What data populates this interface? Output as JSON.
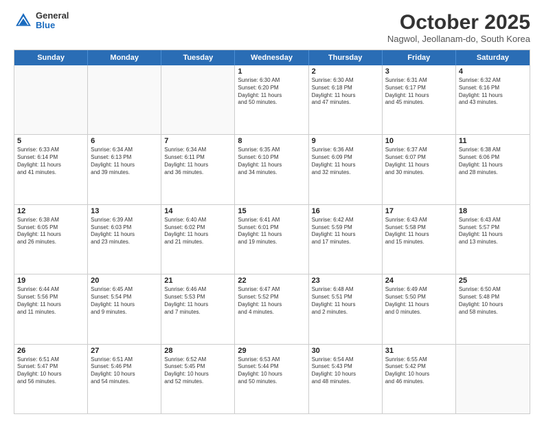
{
  "header": {
    "logo_general": "General",
    "logo_blue": "Blue",
    "month_title": "October 2025",
    "location": "Nagwol, Jeollanam-do, South Korea"
  },
  "days_of_week": [
    "Sunday",
    "Monday",
    "Tuesday",
    "Wednesday",
    "Thursday",
    "Friday",
    "Saturday"
  ],
  "weeks": [
    [
      {
        "day": "",
        "text": ""
      },
      {
        "day": "",
        "text": ""
      },
      {
        "day": "",
        "text": ""
      },
      {
        "day": "1",
        "text": "Sunrise: 6:30 AM\nSunset: 6:20 PM\nDaylight: 11 hours\nand 50 minutes."
      },
      {
        "day": "2",
        "text": "Sunrise: 6:30 AM\nSunset: 6:18 PM\nDaylight: 11 hours\nand 47 minutes."
      },
      {
        "day": "3",
        "text": "Sunrise: 6:31 AM\nSunset: 6:17 PM\nDaylight: 11 hours\nand 45 minutes."
      },
      {
        "day": "4",
        "text": "Sunrise: 6:32 AM\nSunset: 6:16 PM\nDaylight: 11 hours\nand 43 minutes."
      }
    ],
    [
      {
        "day": "5",
        "text": "Sunrise: 6:33 AM\nSunset: 6:14 PM\nDaylight: 11 hours\nand 41 minutes."
      },
      {
        "day": "6",
        "text": "Sunrise: 6:34 AM\nSunset: 6:13 PM\nDaylight: 11 hours\nand 39 minutes."
      },
      {
        "day": "7",
        "text": "Sunrise: 6:34 AM\nSunset: 6:11 PM\nDaylight: 11 hours\nand 36 minutes."
      },
      {
        "day": "8",
        "text": "Sunrise: 6:35 AM\nSunset: 6:10 PM\nDaylight: 11 hours\nand 34 minutes."
      },
      {
        "day": "9",
        "text": "Sunrise: 6:36 AM\nSunset: 6:09 PM\nDaylight: 11 hours\nand 32 minutes."
      },
      {
        "day": "10",
        "text": "Sunrise: 6:37 AM\nSunset: 6:07 PM\nDaylight: 11 hours\nand 30 minutes."
      },
      {
        "day": "11",
        "text": "Sunrise: 6:38 AM\nSunset: 6:06 PM\nDaylight: 11 hours\nand 28 minutes."
      }
    ],
    [
      {
        "day": "12",
        "text": "Sunrise: 6:38 AM\nSunset: 6:05 PM\nDaylight: 11 hours\nand 26 minutes."
      },
      {
        "day": "13",
        "text": "Sunrise: 6:39 AM\nSunset: 6:03 PM\nDaylight: 11 hours\nand 23 minutes."
      },
      {
        "day": "14",
        "text": "Sunrise: 6:40 AM\nSunset: 6:02 PM\nDaylight: 11 hours\nand 21 minutes."
      },
      {
        "day": "15",
        "text": "Sunrise: 6:41 AM\nSunset: 6:01 PM\nDaylight: 11 hours\nand 19 minutes."
      },
      {
        "day": "16",
        "text": "Sunrise: 6:42 AM\nSunset: 5:59 PM\nDaylight: 11 hours\nand 17 minutes."
      },
      {
        "day": "17",
        "text": "Sunrise: 6:43 AM\nSunset: 5:58 PM\nDaylight: 11 hours\nand 15 minutes."
      },
      {
        "day": "18",
        "text": "Sunrise: 6:43 AM\nSunset: 5:57 PM\nDaylight: 11 hours\nand 13 minutes."
      }
    ],
    [
      {
        "day": "19",
        "text": "Sunrise: 6:44 AM\nSunset: 5:56 PM\nDaylight: 11 hours\nand 11 minutes."
      },
      {
        "day": "20",
        "text": "Sunrise: 6:45 AM\nSunset: 5:54 PM\nDaylight: 11 hours\nand 9 minutes."
      },
      {
        "day": "21",
        "text": "Sunrise: 6:46 AM\nSunset: 5:53 PM\nDaylight: 11 hours\nand 7 minutes."
      },
      {
        "day": "22",
        "text": "Sunrise: 6:47 AM\nSunset: 5:52 PM\nDaylight: 11 hours\nand 4 minutes."
      },
      {
        "day": "23",
        "text": "Sunrise: 6:48 AM\nSunset: 5:51 PM\nDaylight: 11 hours\nand 2 minutes."
      },
      {
        "day": "24",
        "text": "Sunrise: 6:49 AM\nSunset: 5:50 PM\nDaylight: 11 hours\nand 0 minutes."
      },
      {
        "day": "25",
        "text": "Sunrise: 6:50 AM\nSunset: 5:48 PM\nDaylight: 10 hours\nand 58 minutes."
      }
    ],
    [
      {
        "day": "26",
        "text": "Sunrise: 6:51 AM\nSunset: 5:47 PM\nDaylight: 10 hours\nand 56 minutes."
      },
      {
        "day": "27",
        "text": "Sunrise: 6:51 AM\nSunset: 5:46 PM\nDaylight: 10 hours\nand 54 minutes."
      },
      {
        "day": "28",
        "text": "Sunrise: 6:52 AM\nSunset: 5:45 PM\nDaylight: 10 hours\nand 52 minutes."
      },
      {
        "day": "29",
        "text": "Sunrise: 6:53 AM\nSunset: 5:44 PM\nDaylight: 10 hours\nand 50 minutes."
      },
      {
        "day": "30",
        "text": "Sunrise: 6:54 AM\nSunset: 5:43 PM\nDaylight: 10 hours\nand 48 minutes."
      },
      {
        "day": "31",
        "text": "Sunrise: 6:55 AM\nSunset: 5:42 PM\nDaylight: 10 hours\nand 46 minutes."
      },
      {
        "day": "",
        "text": ""
      }
    ]
  ]
}
